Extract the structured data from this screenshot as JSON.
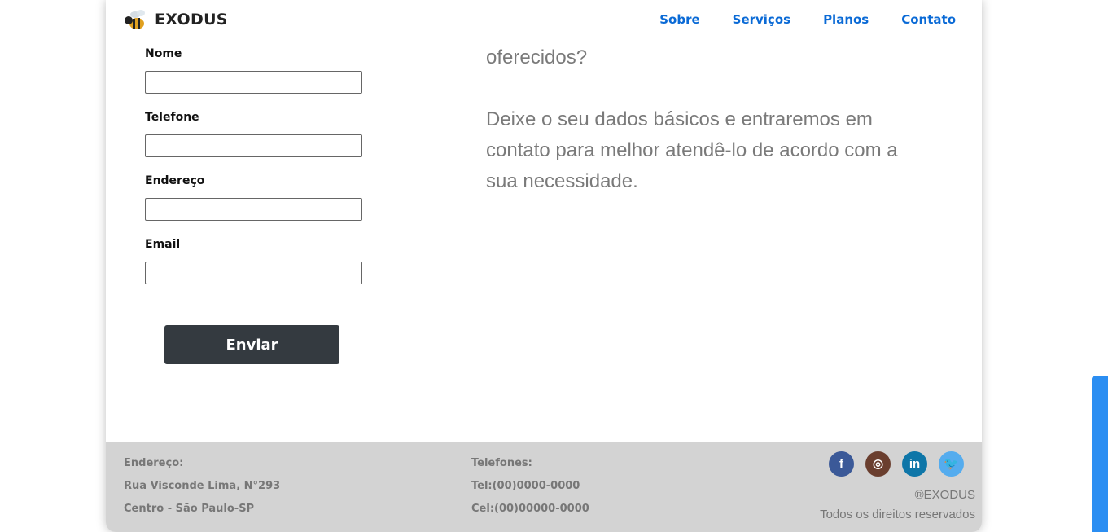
{
  "brand": {
    "name": "EXODUS",
    "logo_icon": "bee-icon"
  },
  "nav": {
    "items": [
      {
        "label": "Sobre"
      },
      {
        "label": "Serviços"
      },
      {
        "label": "Planos"
      },
      {
        "label": "Contato"
      }
    ]
  },
  "form": {
    "fields": [
      {
        "label": "Nome",
        "value": ""
      },
      {
        "label": "Telefone",
        "value": ""
      },
      {
        "label": "Endereço",
        "value": ""
      },
      {
        "label": "Email",
        "value": ""
      }
    ],
    "submit_label": "Enviar"
  },
  "intro": {
    "line_partial": "oferecidos?",
    "paragraph": "Deixe o seu dados básicos e entraremos em contato para melhor atendê-lo de acordo com a sua necessidade."
  },
  "footer": {
    "address": {
      "heading": "Endereço:",
      "line1": "Rua Visconde Lima, N°293",
      "line2": "Centro - São Paulo-SP"
    },
    "phones": {
      "heading": "Telefones:",
      "tel": "Tel:(00)0000-0000",
      "cel": "Cel:(00)00000-0000"
    },
    "social": [
      {
        "name": "facebook-icon",
        "glyph": "f"
      },
      {
        "name": "instagram-icon",
        "glyph": "◎"
      },
      {
        "name": "linkedin-icon",
        "glyph": "in"
      },
      {
        "name": "twitter-icon",
        "glyph": "🐦"
      }
    ],
    "copyright_brand": "®EXODUS",
    "rights": "Todos os direitos reservados"
  },
  "colors": {
    "nav_link": "#0a6ad6",
    "button": "#343a40",
    "footer_bg": "#d3d3d3",
    "scrollbar": "#2b8ef2"
  }
}
